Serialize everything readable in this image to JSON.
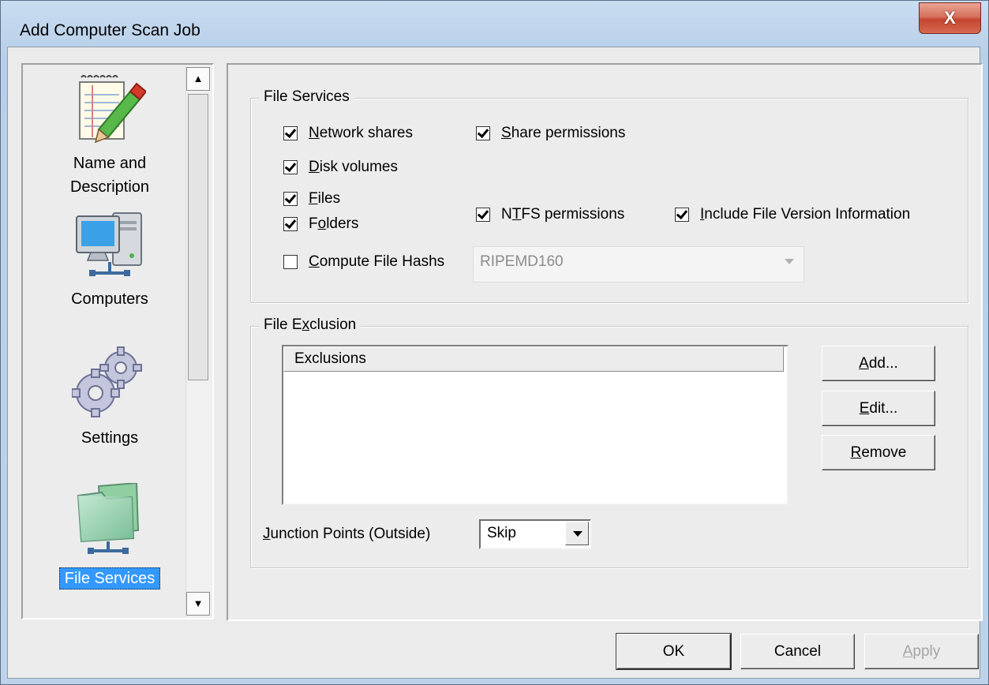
{
  "window": {
    "title": "Add Computer Scan Job",
    "close_glyph": "X"
  },
  "nav": {
    "items": [
      {
        "label": "Name and Description",
        "line1": "Name and",
        "line2": "Description",
        "icon": "notepad-pencil-icon"
      },
      {
        "label": "Computers",
        "icon": "computer-icon"
      },
      {
        "label": "Settings",
        "icon": "gears-icon"
      },
      {
        "label": "File Services",
        "icon": "folder-share-icon",
        "selected": true
      }
    ],
    "scroll_up": "▲",
    "scroll_down": "▼"
  },
  "file_services": {
    "legend": "File Services",
    "network_shares": {
      "pre": "",
      "u": "N",
      "post": "etwork shares",
      "checked": true
    },
    "share_permissions": {
      "pre": "",
      "u": "S",
      "post": "hare permissions",
      "checked": true
    },
    "disk_volumes": {
      "pre": "",
      "u": "D",
      "post": "isk volumes",
      "checked": true
    },
    "files": {
      "pre": "",
      "u": "F",
      "post": "iles",
      "checked": true
    },
    "folders": {
      "pre": "F",
      "u": "o",
      "post": "lders",
      "checked": true
    },
    "ntfs_permissions": {
      "pre": "N",
      "u": "T",
      "post": "FS permissions",
      "checked": true
    },
    "include_file_version": {
      "pre": "",
      "u": "I",
      "post": "nclude File Version Information",
      "checked": true
    },
    "compute_file_hashes": {
      "pre": "",
      "u": "C",
      "post": "ompute File Hashs",
      "checked": false
    },
    "hash_algorithm": "RIPEMD160"
  },
  "file_exclusion": {
    "legend_pre": "File E",
    "legend_u": "x",
    "legend_post": "clusion",
    "column_header": "Exclusions",
    "rows": [],
    "add": {
      "u": "A",
      "post": "dd..."
    },
    "edit": {
      "u": "E",
      "post": "dit..."
    },
    "remove": {
      "u": "R",
      "post": "emove"
    },
    "junction_label_u": "J",
    "junction_label_post": "unction Points (Outside)",
    "junction_value": "Skip"
  },
  "footer": {
    "ok": "OK",
    "cancel": "Cancel",
    "apply_u": "A",
    "apply_post": "pply"
  }
}
